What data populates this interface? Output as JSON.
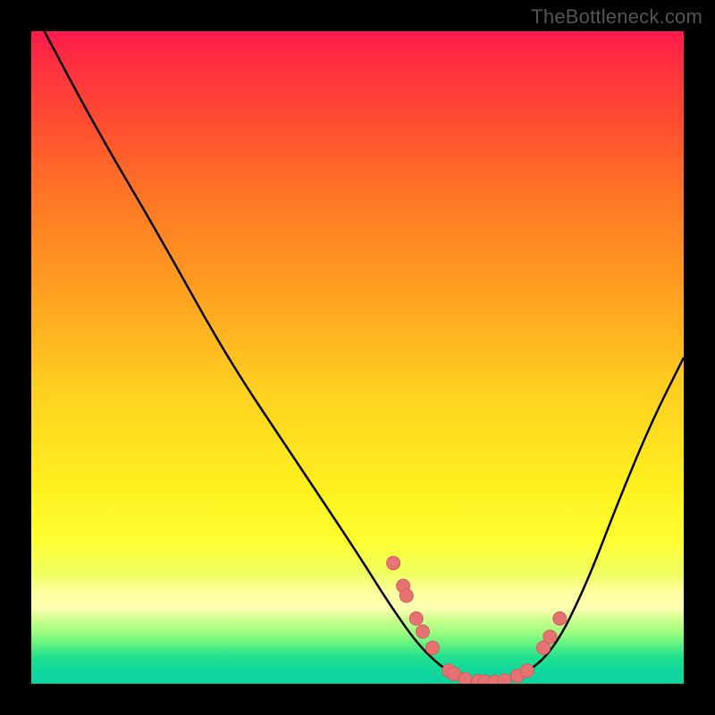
{
  "watermark": "TheBottleneck.com",
  "chart_data": {
    "type": "line",
    "title": "",
    "xlabel": "",
    "ylabel": "",
    "xlim": [
      0,
      100
    ],
    "ylim": [
      0,
      100
    ],
    "curve": {
      "name": "bottleneck-curve",
      "points": [
        {
          "x": 2,
          "y": 100
        },
        {
          "x": 10,
          "y": 85
        },
        {
          "x": 20,
          "y": 68
        },
        {
          "x": 30,
          "y": 50
        },
        {
          "x": 40,
          "y": 35
        },
        {
          "x": 50,
          "y": 20
        },
        {
          "x": 55,
          "y": 12
        },
        {
          "x": 60,
          "y": 5
        },
        {
          "x": 65,
          "y": 1
        },
        {
          "x": 70,
          "y": 0
        },
        {
          "x": 75,
          "y": 1
        },
        {
          "x": 80,
          "y": 5
        },
        {
          "x": 85,
          "y": 15
        },
        {
          "x": 90,
          "y": 28
        },
        {
          "x": 95,
          "y": 40
        },
        {
          "x": 100,
          "y": 50
        }
      ]
    },
    "markers": {
      "name": "highlight-points",
      "points": [
        {
          "x": 55.5,
          "y": 18.5
        },
        {
          "x": 57,
          "y": 15
        },
        {
          "x": 57.5,
          "y": 13.5
        },
        {
          "x": 59,
          "y": 10
        },
        {
          "x": 60,
          "y": 8
        },
        {
          "x": 61.5,
          "y": 5.5
        },
        {
          "x": 64,
          "y": 2
        },
        {
          "x": 64.8,
          "y": 1.5
        },
        {
          "x": 66.5,
          "y": 0.7
        },
        {
          "x": 68.5,
          "y": 0.4
        },
        {
          "x": 69.5,
          "y": 0.3
        },
        {
          "x": 71,
          "y": 0.3
        },
        {
          "x": 72.5,
          "y": 0.5
        },
        {
          "x": 74.5,
          "y": 1.2
        },
        {
          "x": 76,
          "y": 2
        },
        {
          "x": 78.5,
          "y": 5.5
        },
        {
          "x": 79.5,
          "y": 7.2
        },
        {
          "x": 81,
          "y": 10
        }
      ]
    },
    "gradient_zones": {
      "description": "vertical red-to-green gradient background indicating bottleneck severity",
      "top_color": "#ff1a4d",
      "mid_color": "#fff020",
      "bottom_color": "#0cd4a0"
    }
  }
}
